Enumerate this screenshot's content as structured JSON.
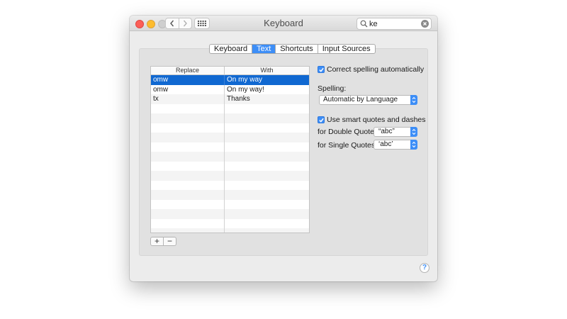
{
  "window": {
    "title": "Keyboard"
  },
  "search": {
    "value": "ke"
  },
  "tabs": [
    {
      "label": "Keyboard",
      "active": false
    },
    {
      "label": "Text",
      "active": true
    },
    {
      "label": "Shortcuts",
      "active": false
    },
    {
      "label": "Input Sources",
      "active": false
    }
  ],
  "table": {
    "headers": {
      "replace": "Replace",
      "with": "With"
    },
    "rows": [
      {
        "replace": "omw",
        "with": "On my way",
        "selected": true
      },
      {
        "replace": "omw",
        "with": "On my way!",
        "selected": false
      },
      {
        "replace": "tx",
        "with": "Thanks",
        "selected": false
      }
    ],
    "buttons": {
      "add": "+",
      "remove": "−"
    }
  },
  "options": {
    "correct_spelling": {
      "label": "Correct spelling automatically",
      "checked": true
    },
    "spelling": {
      "label": "Spelling:",
      "value": "Automatic by Language"
    },
    "smart_quotes": {
      "label": "Use smart quotes and dashes",
      "checked": true
    },
    "double_quotes": {
      "label": "for Double Quotes",
      "value": "“abc”"
    },
    "single_quotes": {
      "label": "for Single Quotes",
      "value": "‘abc’"
    }
  },
  "help": {
    "label": "?"
  },
  "colors": {
    "accent": "#3d8ef7",
    "selection": "#1068d1"
  },
  "icons": [
    "back-chevron-icon",
    "forward-chevron-icon",
    "grid-icon",
    "search-icon",
    "clear-icon",
    "checkmark-icon",
    "popup-arrows-icon"
  ]
}
